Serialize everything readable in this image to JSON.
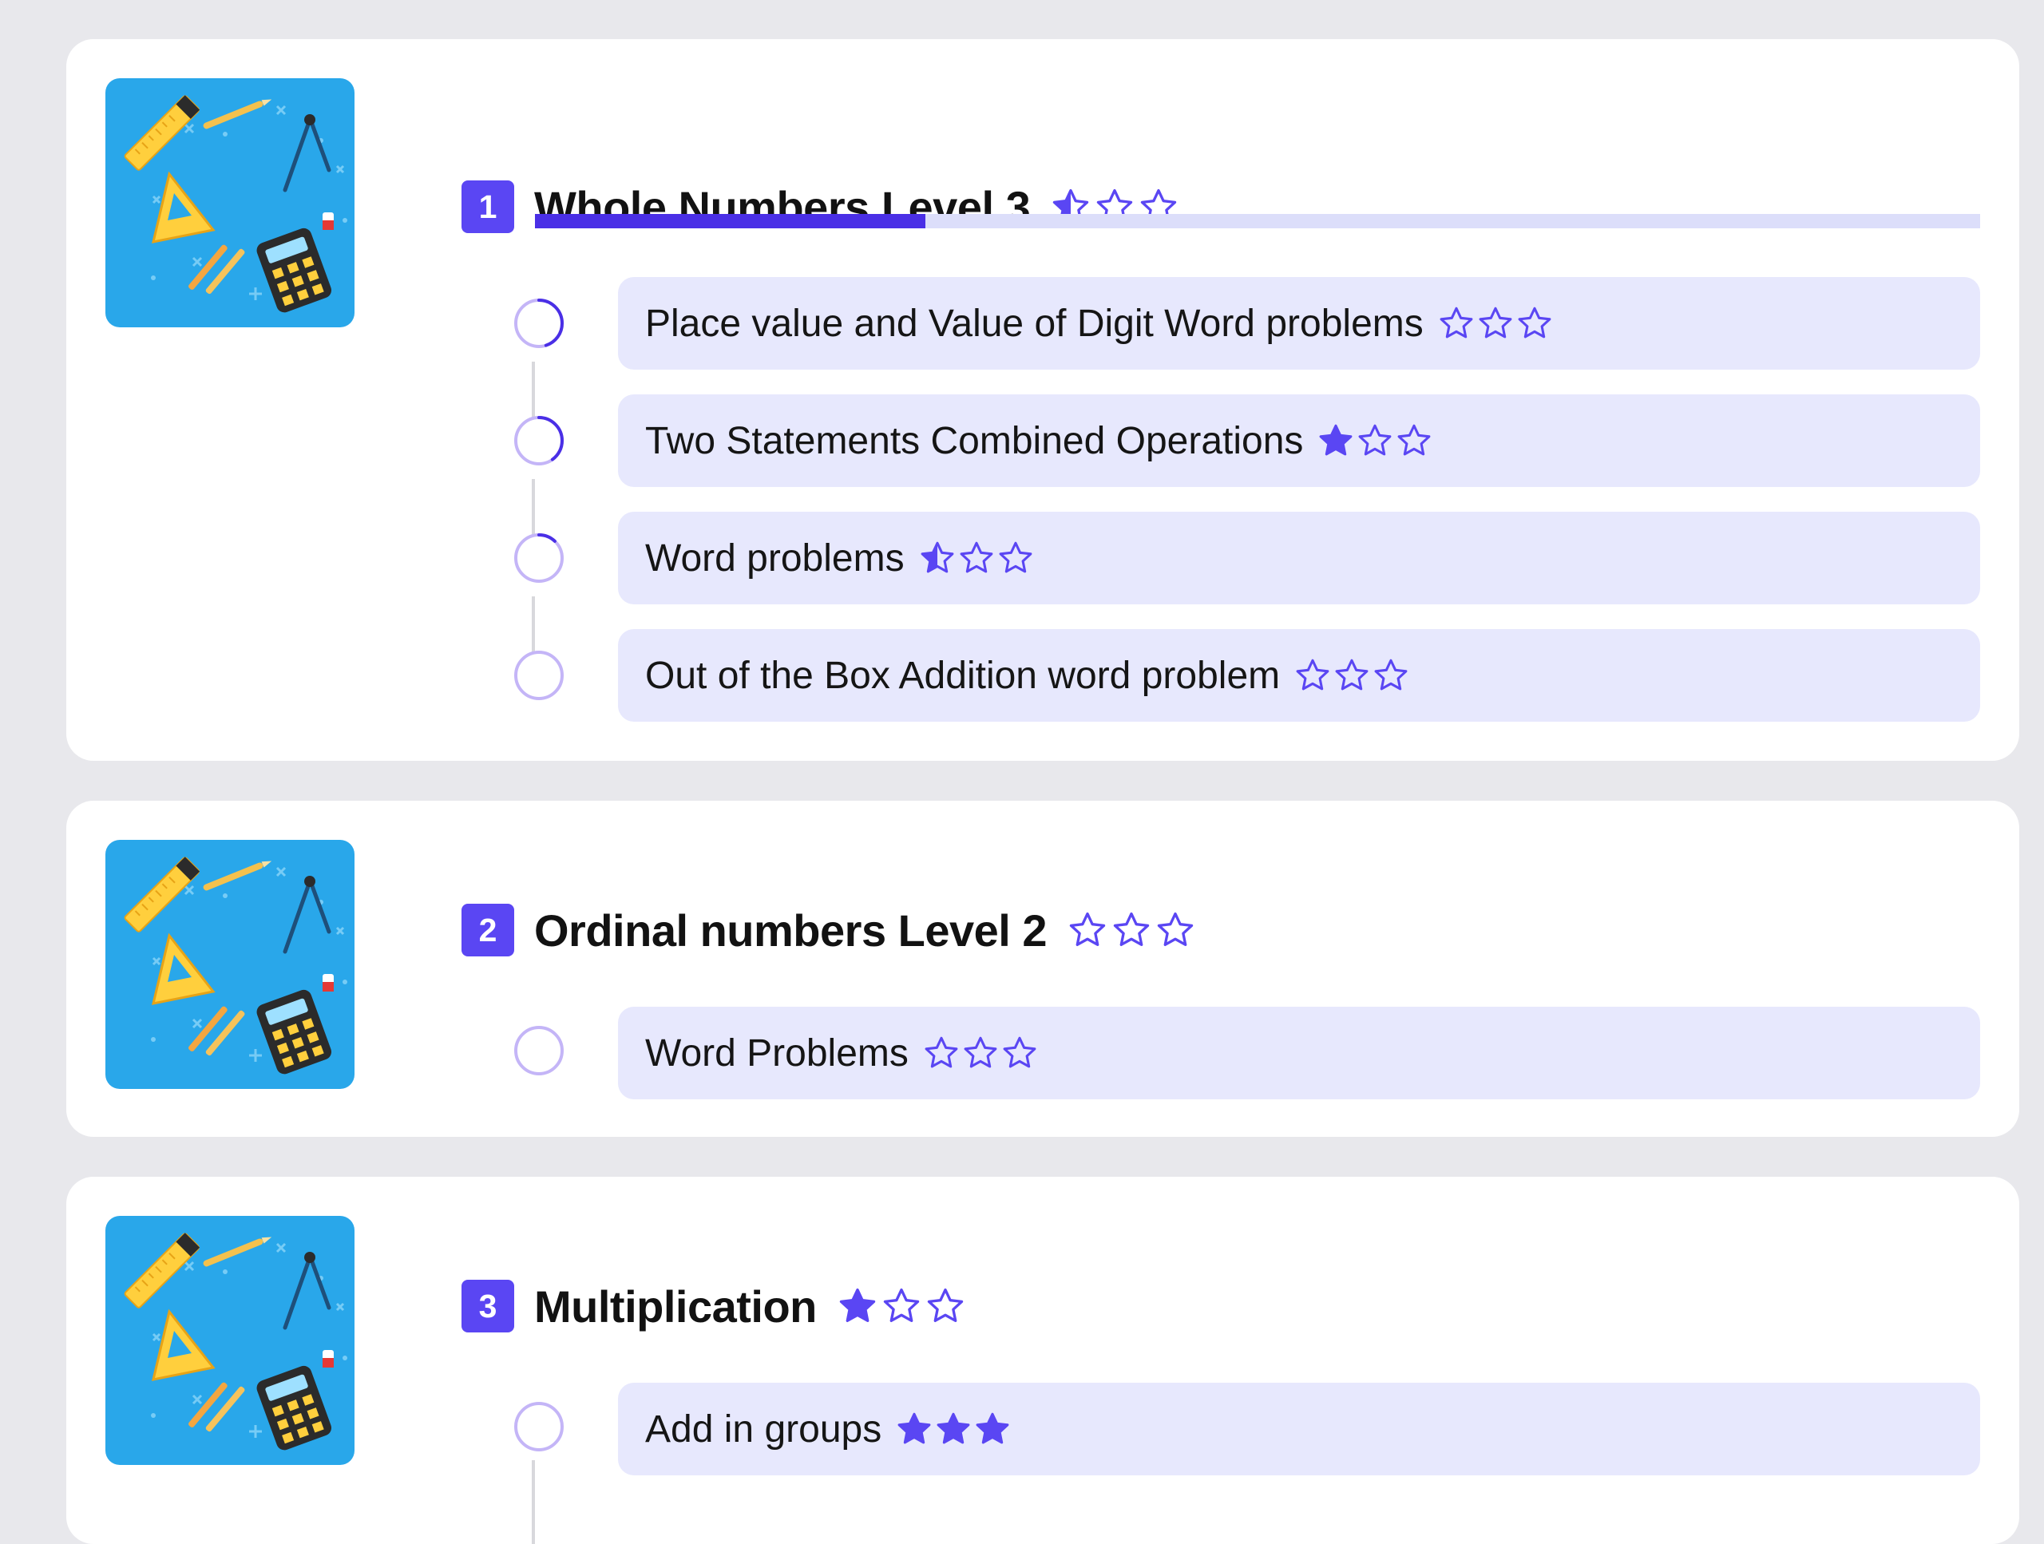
{
  "colors": {
    "accent": "#5a46f3",
    "progress_fill": "#4a2fe6",
    "progress_track": "#dcdefa",
    "lesson_bg": "#e7e8fd",
    "ring": "#c4b5f7",
    "ring_progress": "#4a2fe6",
    "thumbnail_bg": "#29a7ea"
  },
  "units": [
    {
      "number": "1",
      "title": "Whole Numbers Level 3",
      "rating": 0.5,
      "progress": 0.27,
      "thumbnail_icon": "math-tools-icon",
      "lessons": [
        {
          "label": "Place value and Value of Digit Word problems",
          "rating": 0,
          "ring_progress": 0.45
        },
        {
          "label": "Two Statements Combined Operations",
          "rating": 1,
          "ring_progress": 0.4
        },
        {
          "label": "Word problems",
          "rating": 0.5,
          "ring_progress": 0.12
        },
        {
          "label": "Out of the Box Addition word problem",
          "rating": 0,
          "ring_progress": 0
        }
      ]
    },
    {
      "number": "2",
      "title": "Ordinal numbers Level 2",
      "rating": 0,
      "thumbnail_icon": "math-tools-icon",
      "lessons": [
        {
          "label": "Word Problems",
          "rating": 0,
          "ring_progress": 0
        }
      ]
    },
    {
      "number": "3",
      "title": "Multiplication",
      "rating": 1,
      "thumbnail_icon": "math-tools-icon",
      "lessons": [
        {
          "label": "Add in groups",
          "rating": 3,
          "ring_progress": 0
        }
      ]
    }
  ]
}
